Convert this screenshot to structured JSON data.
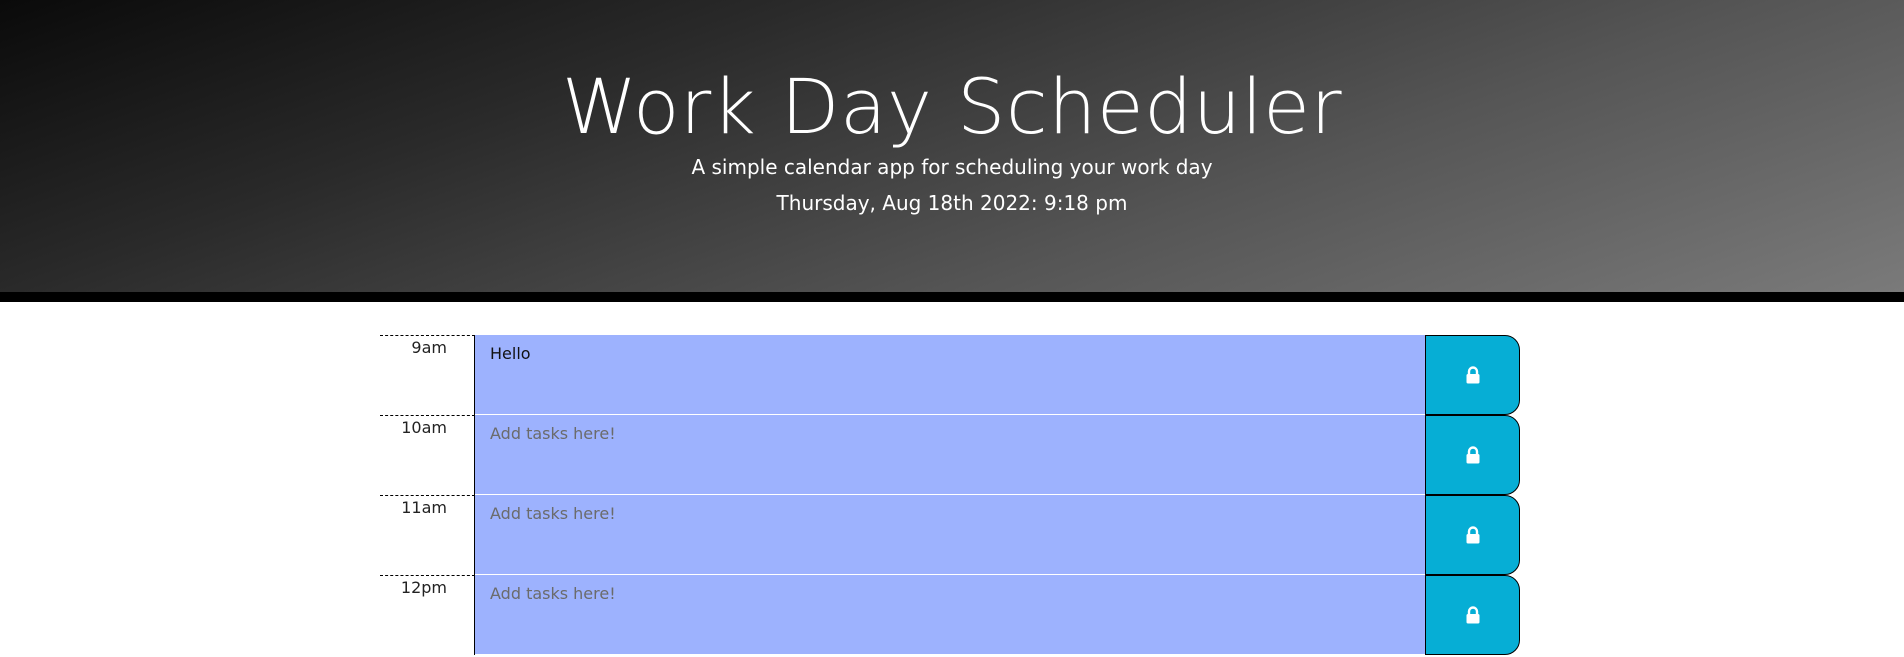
{
  "header": {
    "title": "Work Day Scheduler",
    "subtitle": "A simple calendar app for scheduling your work day",
    "current_day": "Thursday, Aug 18th 2022: 9:18 pm"
  },
  "colors": {
    "past": "#9db2fe",
    "save_button": "#06aed5",
    "header_gradient_dark": "#0a0a0a",
    "header_gradient_light": "#7a7a7a"
  },
  "schedule": [
    {
      "hour": "9am",
      "value": "Hello",
      "placeholder": "Add tasks here!",
      "button_icon": "lock-icon"
    },
    {
      "hour": "10am",
      "value": "",
      "placeholder": "Add tasks here!",
      "button_icon": "lock-icon"
    },
    {
      "hour": "11am",
      "value": "",
      "placeholder": "Add tasks here!",
      "button_icon": "lock-icon"
    },
    {
      "hour": "12pm",
      "value": "",
      "placeholder": "Add tasks here!",
      "button_icon": "lock-icon"
    }
  ]
}
